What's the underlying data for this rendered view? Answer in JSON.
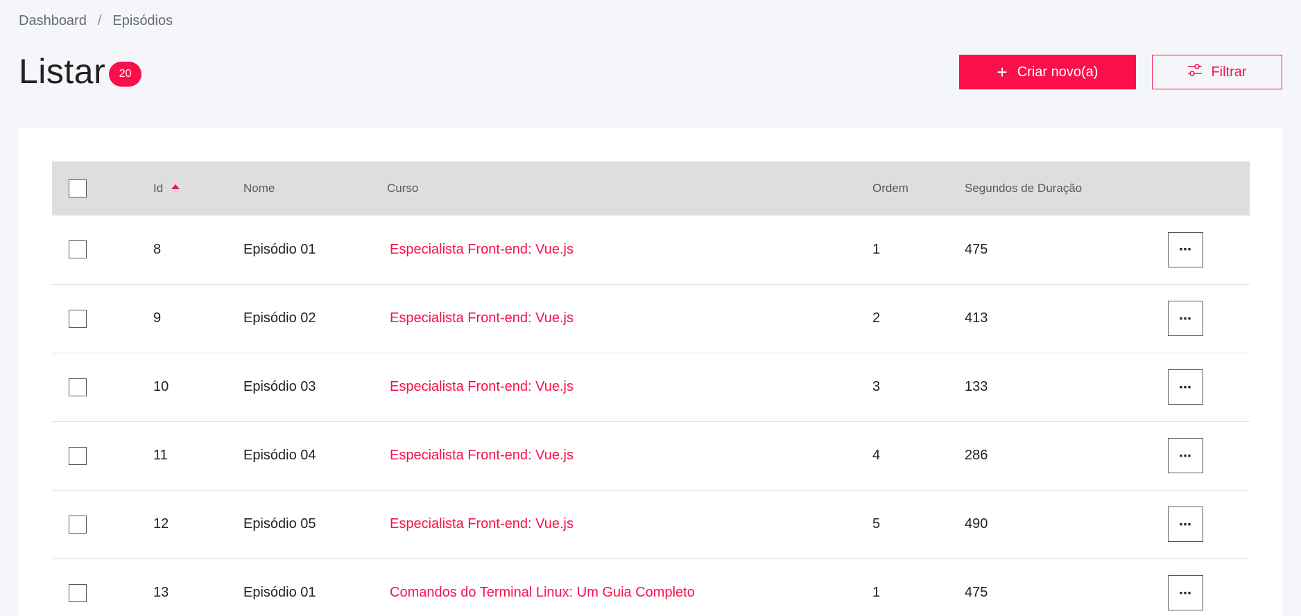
{
  "breadcrumb": {
    "items": [
      "Dashboard",
      "Episódios"
    ],
    "separator": "/"
  },
  "header": {
    "title": "Listar",
    "count": "20",
    "create_button": {
      "icon": "plus-icon",
      "plus": "+",
      "label": "Criar novo(a)"
    },
    "filter_button": {
      "icon": "sliders-icon",
      "label": "Filtrar"
    }
  },
  "table": {
    "columns": [
      "Id",
      "Nome",
      "Curso",
      "Ordem",
      "Segundos de Duração"
    ],
    "sort": {
      "column": "Id",
      "direction": "ascending"
    },
    "action_label": "⋯",
    "rows": [
      {
        "id": "8",
        "nome": "Episódio 01",
        "curso": "Especialista Front-end: Vue.js",
        "ordem": "1",
        "segundos": "475"
      },
      {
        "id": "9",
        "nome": "Episódio 02",
        "curso": "Especialista Front-end: Vue.js",
        "ordem": "2",
        "segundos": "413"
      },
      {
        "id": "10",
        "nome": "Episódio 03",
        "curso": "Especialista Front-end: Vue.js",
        "ordem": "3",
        "segundos": "133"
      },
      {
        "id": "11",
        "nome": "Episódio 04",
        "curso": "Especialista Front-end: Vue.js",
        "ordem": "4",
        "segundos": "286"
      },
      {
        "id": "12",
        "nome": "Episódio 05",
        "curso": "Especialista Front-end: Vue.js",
        "ordem": "5",
        "segundos": "490"
      },
      {
        "id": "13",
        "nome": "Episódio 01",
        "curso": "Comandos do Terminal Linux: Um Guia Completo",
        "ordem": "1",
        "segundos": "475"
      }
    ]
  },
  "colors": {
    "accent": "#fa0f4b",
    "background": "#f5f6fa",
    "card": "#ffffff",
    "table_header": "#dedede"
  }
}
